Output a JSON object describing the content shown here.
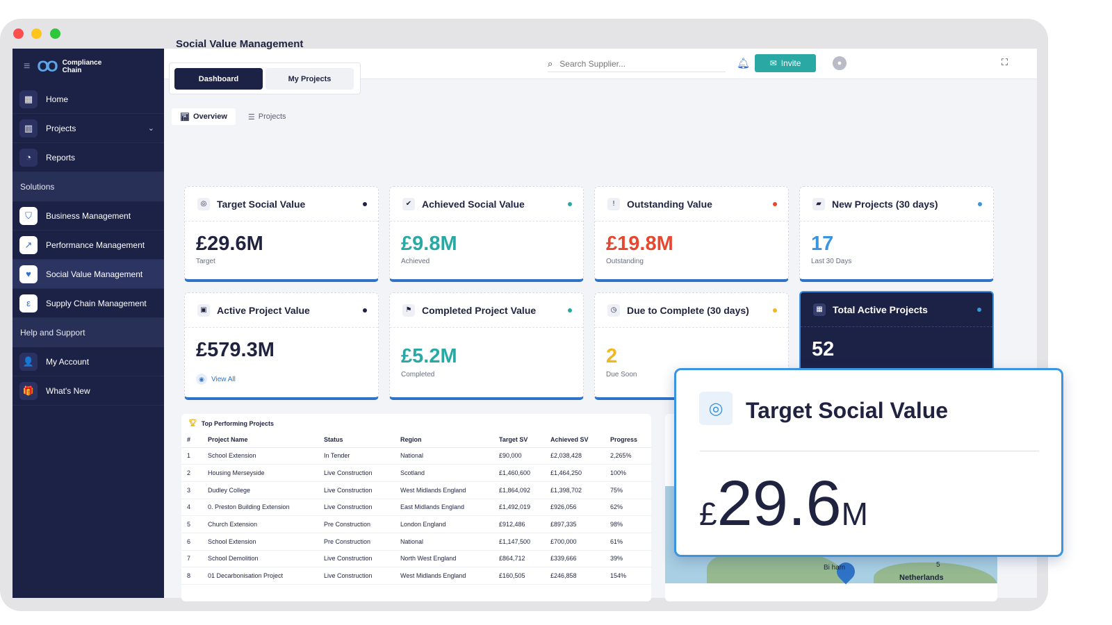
{
  "brand": {
    "line1": "Compliance",
    "line2": "Chain"
  },
  "sidebar": {
    "items": [
      {
        "label": "Home"
      },
      {
        "label": "Projects"
      },
      {
        "label": "Reports"
      }
    ],
    "solutions_header": "Solutions",
    "solutions": [
      {
        "label": "Business Management"
      },
      {
        "label": "Performance Management"
      },
      {
        "label": "Social Value Management"
      },
      {
        "label": "Supply Chain Management"
      }
    ],
    "help_header": "Help and Support",
    "help": [
      {
        "label": "My Account"
      },
      {
        "label": "What's New"
      }
    ]
  },
  "topbar": {
    "search_placeholder": "Search Supplier...",
    "invite_label": "Invite"
  },
  "main": {
    "title": "Social Value Management",
    "seg_tabs": [
      "Dashboard",
      "My Projects"
    ],
    "sub_tabs": [
      "Overview",
      "Projects"
    ]
  },
  "cards": [
    {
      "title": "Target Social Value",
      "value": "£29.6M",
      "sub": "Target",
      "dot_color": "#1f2340",
      "value_color": "#1f2340"
    },
    {
      "title": "Achieved Social Value",
      "value": "£9.8M",
      "sub": "Achieved",
      "dot_color": "#2aa9a4",
      "value_color": "#2aa9a4"
    },
    {
      "title": "Outstanding Value",
      "value": "£19.8M",
      "sub": "Outstanding",
      "dot_color": "#e8472f",
      "value_color": "#e8472f"
    },
    {
      "title": "New Projects (30 days)",
      "value": "17",
      "sub": "Last 30 Days",
      "dot_color": "#3a94de",
      "value_color": "#3a94de"
    },
    {
      "title": "Active Project Value",
      "value": "£579.3M",
      "link": "View All",
      "dot_color": "#1f2340",
      "value_color": "#1f2340"
    },
    {
      "title": "Completed Project Value",
      "value": "£5.2M",
      "sub": "Completed",
      "dot_color": "#2aa9a4",
      "value_color": "#2aa9a4"
    },
    {
      "title": "Due to Complete (30 days)",
      "value": "2",
      "sub": "Due Soon",
      "dot_color": "#f0b81e",
      "value_color": "#f0b81e"
    },
    {
      "title": "Total Active Projects",
      "value": "52",
      "dot_color": "#3a94de",
      "value_color": "#ffffff"
    }
  ],
  "table": {
    "title": "Top Performing Projects",
    "columns": [
      "#",
      "Project Name",
      "Status",
      "Region",
      "Target SV",
      "Achieved SV",
      "Progress"
    ],
    "rows": [
      [
        "1",
        "School Extension",
        "In Tender",
        "National",
        "£90,000",
        "£2,038,428",
        "2,265%"
      ],
      [
        "2",
        "Housing Merseyside",
        "Live Construction",
        "Scotland",
        "£1,460,600",
        "£1,464,250",
        "100%"
      ],
      [
        "3",
        "Dudley College",
        "Live Construction",
        "West Midlands England",
        "£1,864,092",
        "£1,398,702",
        "75%"
      ],
      [
        "4",
        "0. Preston Building Extension",
        "Live Construction",
        "East Midlands England",
        "£1,492,019",
        "£926,056",
        "62%"
      ],
      [
        "5",
        "Church Extension",
        "Pre Construction",
        "London England",
        "£912,486",
        "£897,335",
        "98%"
      ],
      [
        "6",
        "School Extension",
        "Pre Construction",
        "National",
        "£1,147,500",
        "£700,000",
        "61%"
      ],
      [
        "7",
        "School Demolition",
        "Live Construction",
        "North West England",
        "£864,712",
        "£339,666",
        "39%"
      ],
      [
        "8",
        "01 Decarbonisation Project",
        "Live Construction",
        "West Midlands England",
        "£160,505",
        "£246,858",
        "154%"
      ]
    ]
  },
  "map": {
    "label_netherlands": "Netherlands",
    "label_city": "Bi      ham",
    "label_num": "5"
  },
  "popup": {
    "title": "Target Social Value",
    "currency": "£",
    "number": "29.6",
    "unit": "M"
  }
}
